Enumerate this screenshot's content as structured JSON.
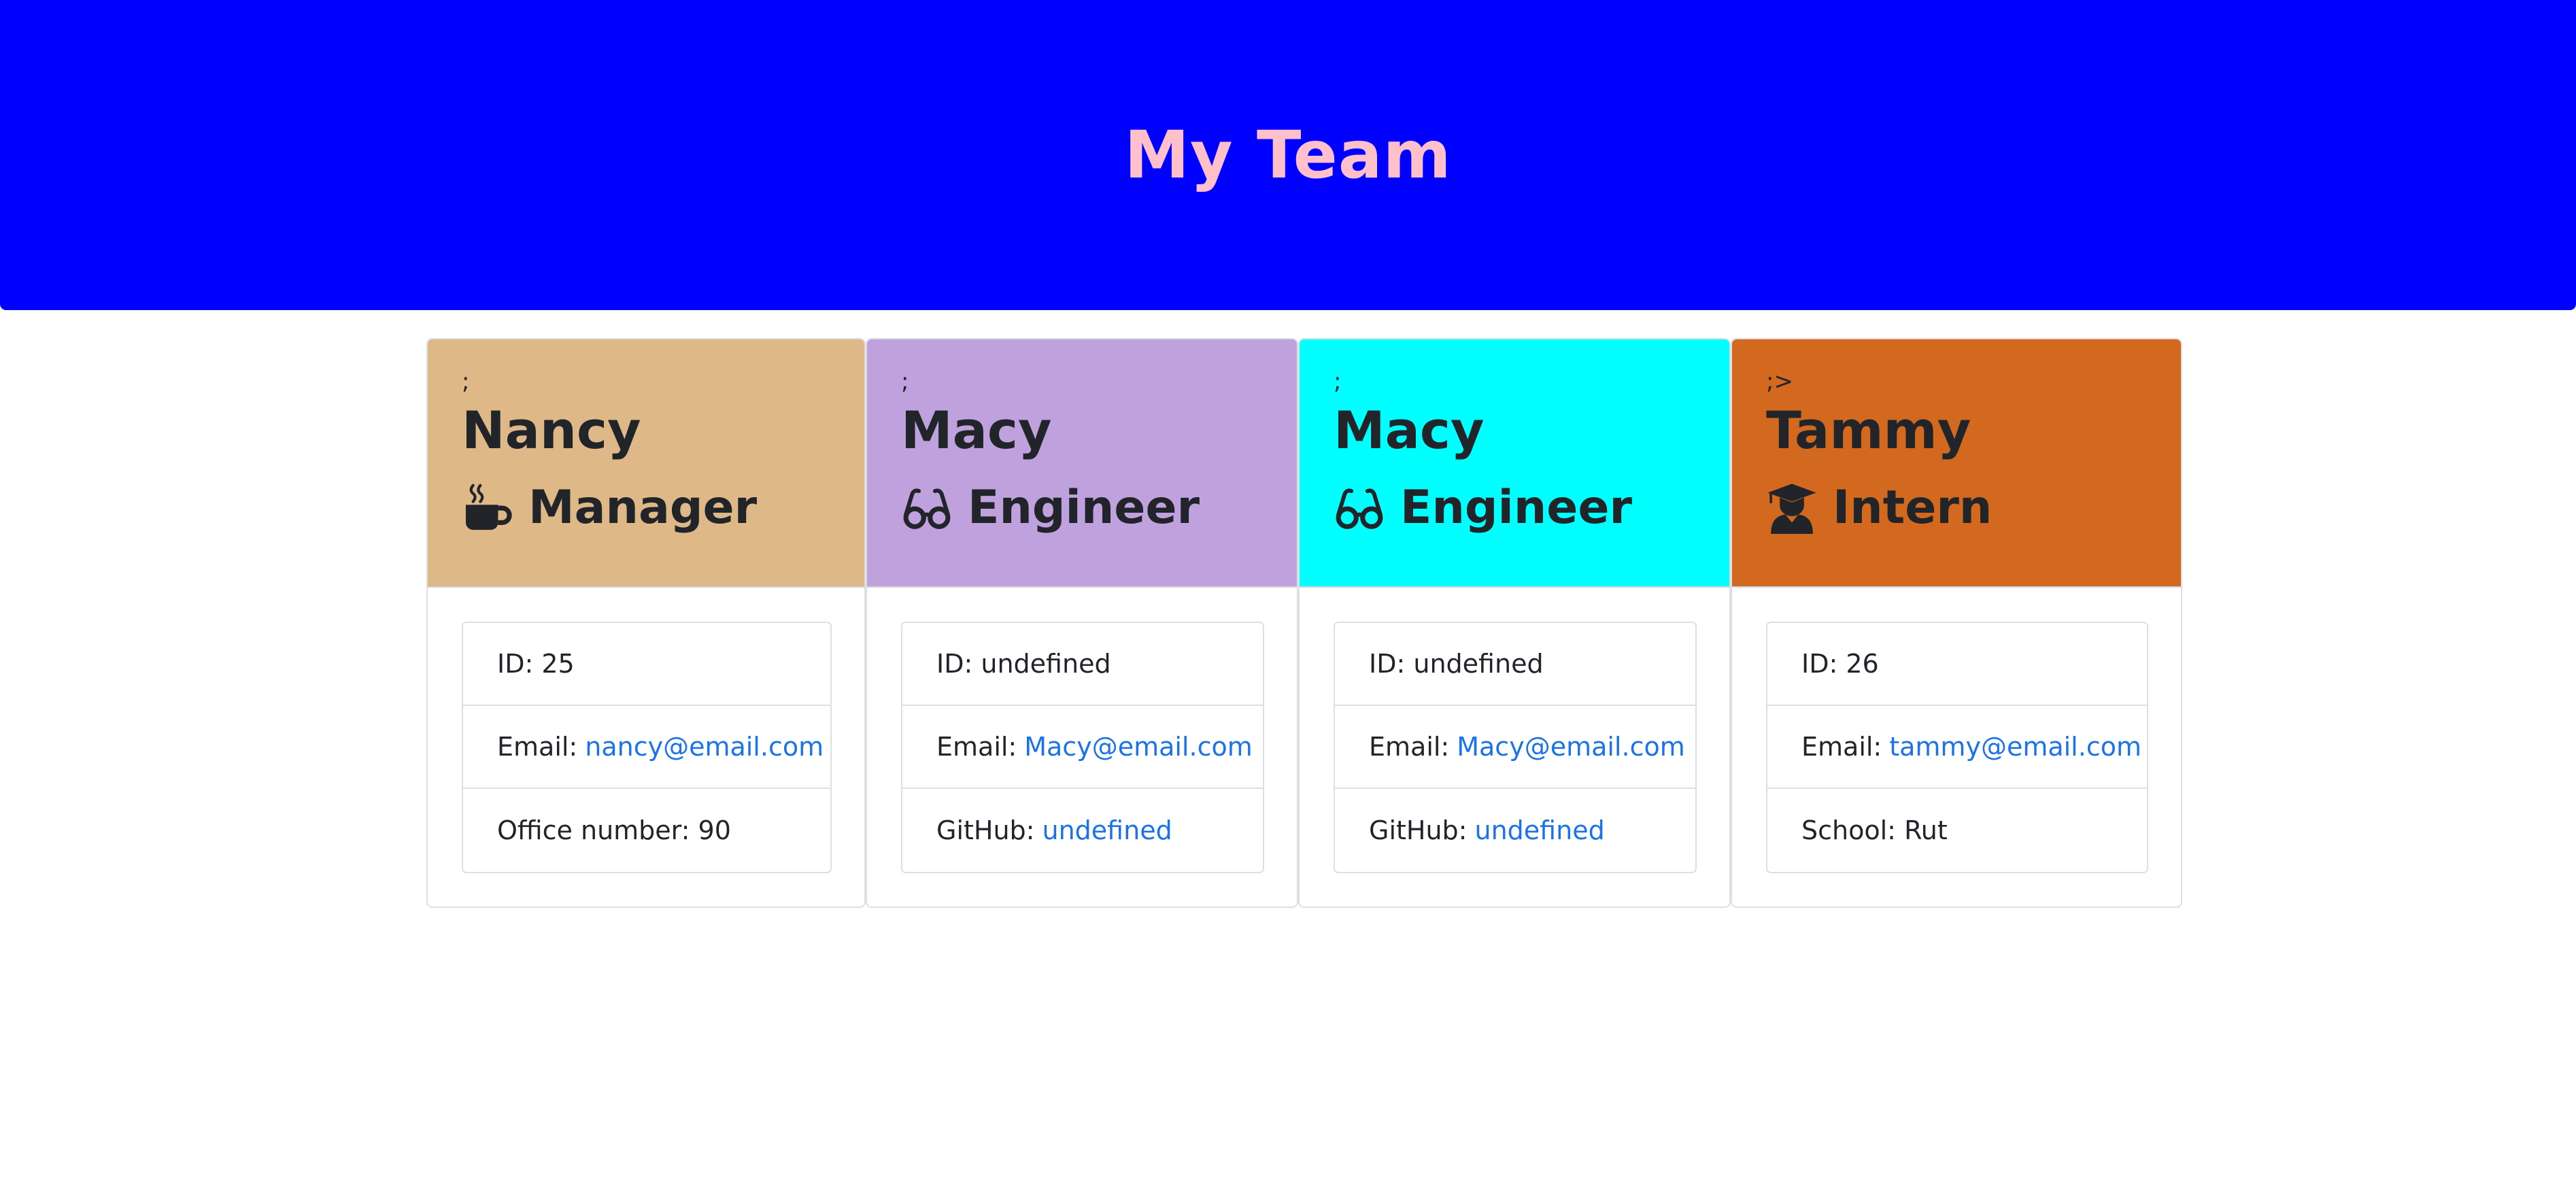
{
  "header": {
    "title": "My Team"
  },
  "colors": {
    "banner": "#0000ff",
    "title": "#ffc0cb",
    "manager": "#deb887",
    "engineer_1": "#bfa1de",
    "engineer_2": "#00ffff",
    "intern": "#d2691e",
    "link": "#1a73e8"
  },
  "cards": [
    {
      "mark": ";",
      "name": "Nancy",
      "role": "Manager",
      "icon": "coffee-mug-icon",
      "id_label": "ID:",
      "id": "25",
      "email_label": "Email:",
      "email": "nancy@email.com",
      "extra_label": "Office number:",
      "extra": "90"
    },
    {
      "mark": ";",
      "name": "Macy",
      "role": "Engineer",
      "icon": "glasses-icon",
      "id_label": "ID:",
      "id": "undefined",
      "email_label": "Email:",
      "email": "Macy@email.com",
      "extra_label": "GitHub:",
      "extra": "undefined"
    },
    {
      "mark": ";",
      "name": "Macy",
      "role": "Engineer",
      "icon": "glasses-icon",
      "id_label": "ID:",
      "id": "undefined",
      "email_label": "Email:",
      "email": "Macy@email.com",
      "extra_label": "GitHub:",
      "extra": "undefined"
    },
    {
      "mark": ";>",
      "name": "Tammy",
      "role": "Intern",
      "icon": "graduate-icon",
      "id_label": "ID:",
      "id": "26",
      "email_label": "Email:",
      "email": "tammy@email.com",
      "extra_label": "School:",
      "extra": "Rut"
    }
  ]
}
